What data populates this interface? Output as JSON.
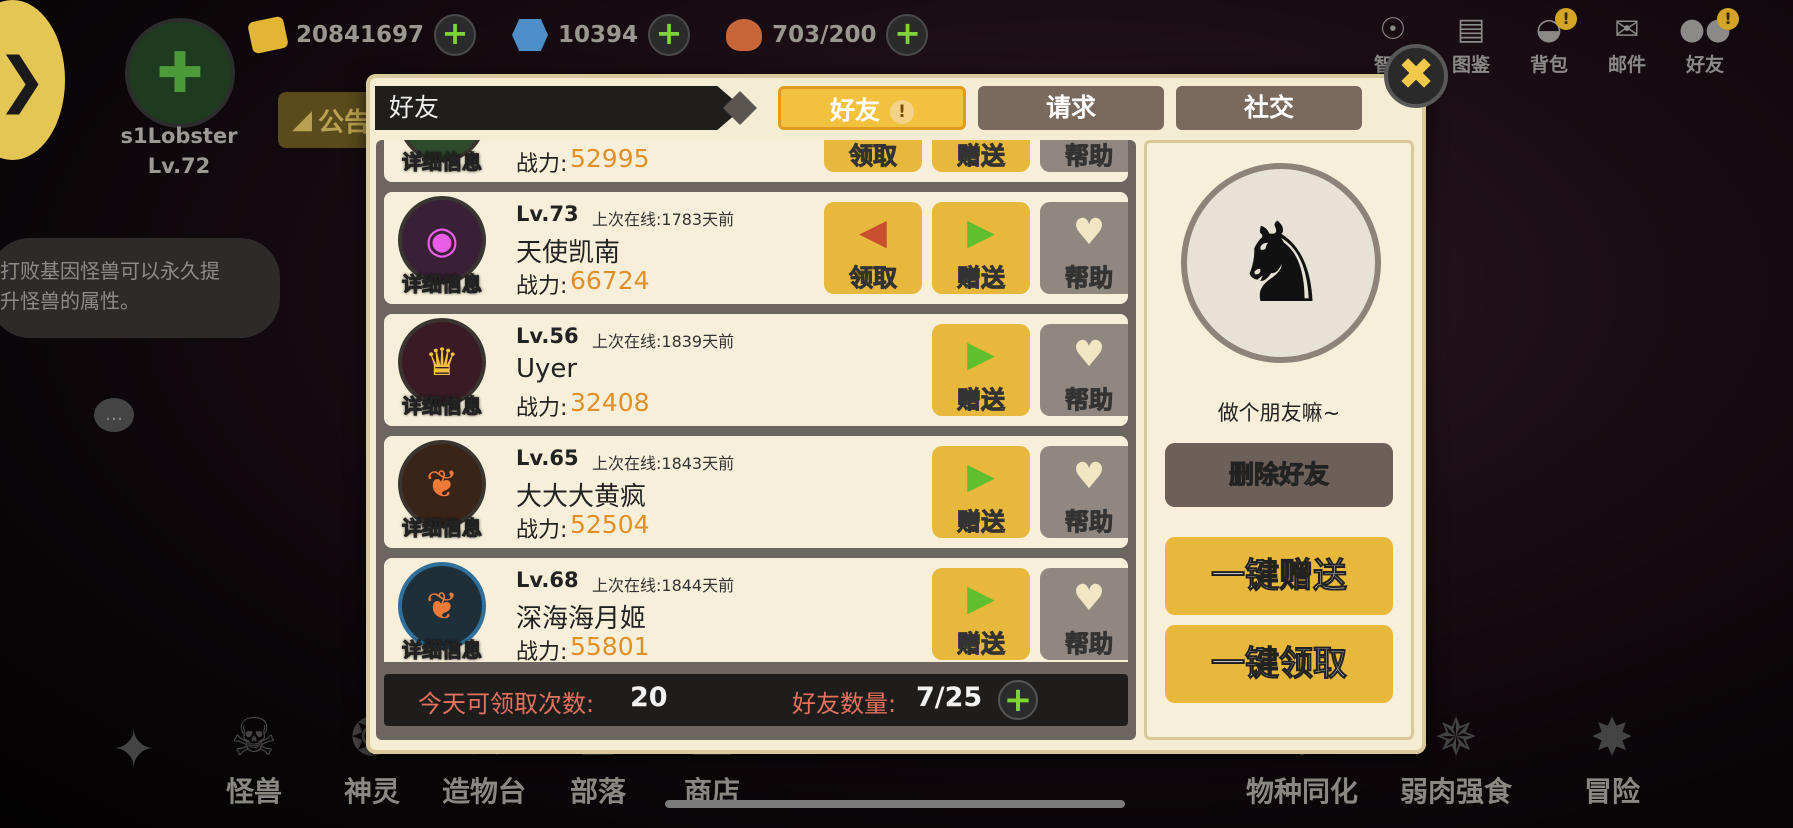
{
  "hud": {
    "resources": [
      {
        "icon": "gold-coin-icon",
        "value": "20841697"
      },
      {
        "icon": "gem-icon",
        "value": "10394"
      },
      {
        "icon": "meat-icon",
        "value": "703/200"
      }
    ],
    "player": {
      "name": "s1Lobster",
      "level": "Lv.72"
    },
    "notice_label": "公告",
    "tip_text_line1": "打败基因怪兽可以永久提",
    "tip_text_line2": "升怪兽的属性。",
    "top_right": [
      {
        "label": "智者",
        "icon": "bulb-icon"
      },
      {
        "label": "图鉴",
        "icon": "cards-icon"
      },
      {
        "label": "背包",
        "icon": "bag-icon"
      },
      {
        "label": "邮件",
        "icon": "mail-icon"
      },
      {
        "label": "好友",
        "icon": "friends-icon"
      }
    ]
  },
  "bottom_nav": [
    {
      "label": "",
      "icon": "compass-star-icon"
    },
    {
      "label": "怪兽",
      "icon": "monster-icon"
    },
    {
      "label": "神灵",
      "icon": "spirit-icon"
    },
    {
      "label": "造物台",
      "icon": "forge-icon"
    },
    {
      "label": "部落",
      "icon": "tribe-icon"
    },
    {
      "label": "商店",
      "icon": "shop-icon"
    },
    {
      "label": "物种同化",
      "icon": "species-icon"
    },
    {
      "label": "弱肉强食",
      "icon": "predator-icon"
    },
    {
      "label": "冒险",
      "icon": "adventure-icon"
    }
  ],
  "modal": {
    "title": "好友",
    "tabs": [
      {
        "label": "好友",
        "active": true
      },
      {
        "label": "请求",
        "active": false
      },
      {
        "label": "社交",
        "active": false
      }
    ],
    "detail_label": "详细信息",
    "power_label": "战力:",
    "btn_claim": "领取",
    "btn_gift": "赠送",
    "btn_help": "帮助",
    "friends": [
      {
        "level": "",
        "last_seen": "",
        "name": "",
        "power": "52995",
        "claim": true
      },
      {
        "level": "Lv.73",
        "last_seen": "上次在线:1783天前",
        "name": "天使凯南",
        "power": "66724",
        "claim": true
      },
      {
        "level": "Lv.56",
        "last_seen": "上次在线:1839天前",
        "name": "Uyer",
        "power": "32408",
        "claim": false
      },
      {
        "level": "Lv.65",
        "last_seen": "上次在线:1843天前",
        "name": "大大大黄疯",
        "power": "52504",
        "claim": false
      },
      {
        "level": "Lv.68",
        "last_seen": "上次在线:1844天前",
        "name": "深海海月姬",
        "power": "55801",
        "claim": false
      }
    ],
    "status": {
      "claims_label": "今天可领取次数:",
      "claims_value": "20",
      "friends_label": "好友数量:",
      "friends_value": "7/25"
    },
    "side": {
      "caption": "做个朋友嘛~",
      "delete_label": "删除好友",
      "gift_all_label": "一键赠送",
      "claim_all_label": "一键领取"
    }
  },
  "colors": {
    "accent_gold": "#e7b83c",
    "power_orange": "#e0902a",
    "status_red": "#e4715d",
    "plus_green": "#7ed33a"
  }
}
